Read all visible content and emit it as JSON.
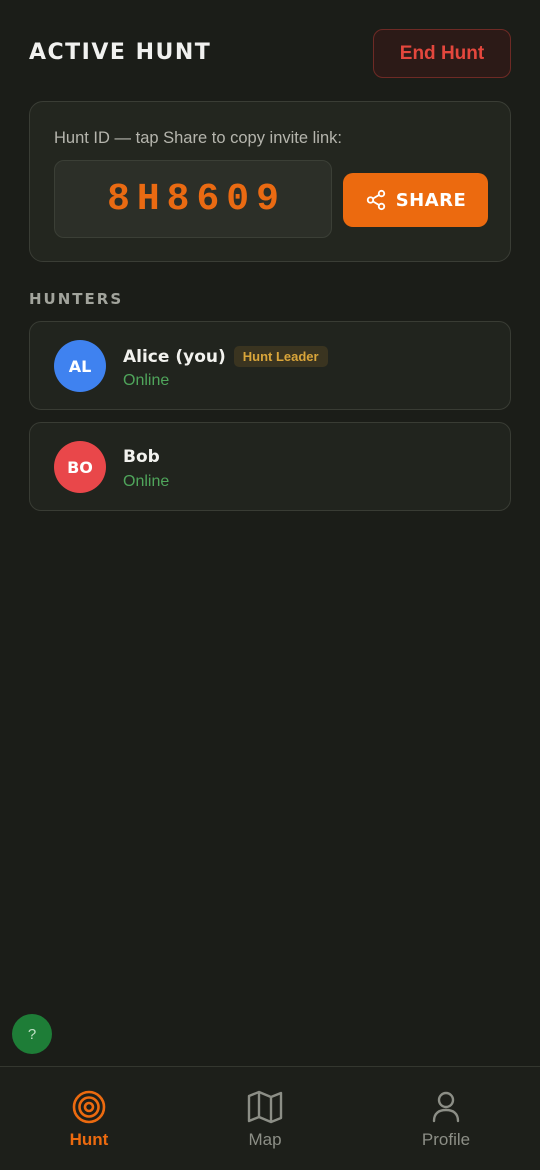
{
  "header": {
    "title": "ACTIVE HUNT",
    "end_hunt_label": "End Hunt"
  },
  "hunt_card": {
    "label": "Hunt ID — tap Share to copy invite link:",
    "hunt_id": "8H8609",
    "share_label": "SHARE"
  },
  "hunters": {
    "heading": "HUNTERS",
    "items": [
      {
        "initials": "AL",
        "name": "Alice (you)",
        "badge": "Hunt Leader",
        "status": "Online",
        "avatar_color": "#3f82f0"
      },
      {
        "initials": "BO",
        "name": "Bob",
        "badge": "",
        "status": "Online",
        "avatar_color": "#e9474a"
      }
    ]
  },
  "help": {
    "label": "?"
  },
  "nav": {
    "tabs": [
      {
        "label": "Hunt",
        "icon": "target-icon",
        "active": true
      },
      {
        "label": "Map",
        "icon": "map-icon",
        "active": false
      },
      {
        "label": "Profile",
        "icon": "user-icon",
        "active": false
      }
    ]
  },
  "colors": {
    "accent": "#ec6a0f",
    "danger": "#e4473d",
    "online": "#4fa55b",
    "badge": "#d9a53a"
  }
}
